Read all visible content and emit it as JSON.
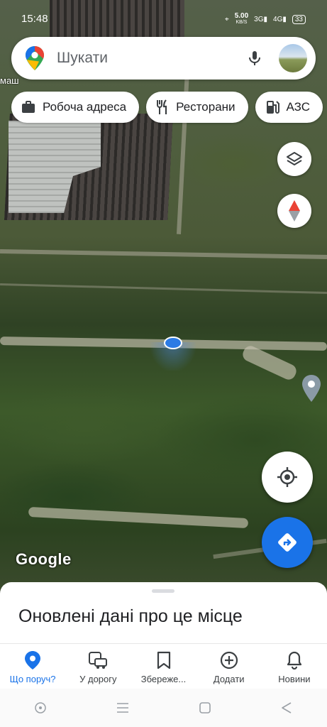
{
  "status_bar": {
    "time": "15:48",
    "net_speed_value": "5.00",
    "net_speed_unit": "KB/S",
    "signal_1": "3G",
    "signal_2": "4G",
    "battery": "33"
  },
  "search": {
    "placeholder": "Шукати"
  },
  "map": {
    "place_label": "маш",
    "attribution": "Google"
  },
  "chips": [
    {
      "label": "Робоча адреса",
      "icon": "briefcase-icon"
    },
    {
      "label": "Ресторани",
      "icon": "fork-knife-icon"
    },
    {
      "label": "АЗС",
      "icon": "gas-station-icon"
    }
  ],
  "sheet": {
    "title": "Оновлені дані про це місце"
  },
  "bottom_nav": [
    {
      "label": "Що поруч?",
      "icon": "explore-pin-icon",
      "active": true
    },
    {
      "label": "У дорогу",
      "icon": "commute-icon"
    },
    {
      "label": "Збереже...",
      "icon": "bookmark-icon"
    },
    {
      "label": "Додати",
      "icon": "add-circle-icon"
    },
    {
      "label": "Новини",
      "icon": "bell-icon"
    }
  ],
  "colors": {
    "accent": "#1a73e8",
    "directions_fab": "#1a73e8"
  }
}
